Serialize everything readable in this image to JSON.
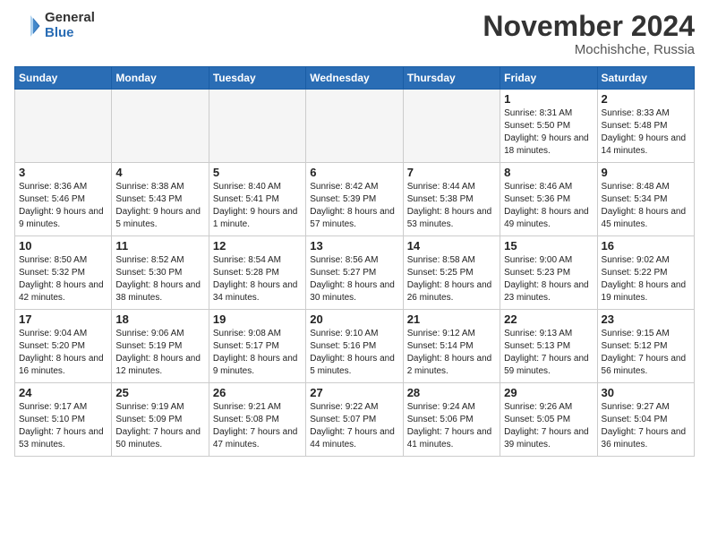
{
  "logo": {
    "general": "General",
    "blue": "Blue"
  },
  "header": {
    "month": "November 2024",
    "location": "Mochishche, Russia"
  },
  "weekdays": [
    "Sunday",
    "Monday",
    "Tuesday",
    "Wednesday",
    "Thursday",
    "Friday",
    "Saturday"
  ],
  "weeks": [
    [
      {
        "day": "",
        "empty": true
      },
      {
        "day": "",
        "empty": true
      },
      {
        "day": "",
        "empty": true
      },
      {
        "day": "",
        "empty": true
      },
      {
        "day": "",
        "empty": true
      },
      {
        "day": "1",
        "sunrise": "8:31 AM",
        "sunset": "5:50 PM",
        "daylight": "9 hours and 18 minutes."
      },
      {
        "day": "2",
        "sunrise": "8:33 AM",
        "sunset": "5:48 PM",
        "daylight": "9 hours and 14 minutes."
      }
    ],
    [
      {
        "day": "3",
        "sunrise": "8:36 AM",
        "sunset": "5:46 PM",
        "daylight": "9 hours and 9 minutes."
      },
      {
        "day": "4",
        "sunrise": "8:38 AM",
        "sunset": "5:43 PM",
        "daylight": "9 hours and 5 minutes."
      },
      {
        "day": "5",
        "sunrise": "8:40 AM",
        "sunset": "5:41 PM",
        "daylight": "9 hours and 1 minute."
      },
      {
        "day": "6",
        "sunrise": "8:42 AM",
        "sunset": "5:39 PM",
        "daylight": "8 hours and 57 minutes."
      },
      {
        "day": "7",
        "sunrise": "8:44 AM",
        "sunset": "5:38 PM",
        "daylight": "8 hours and 53 minutes."
      },
      {
        "day": "8",
        "sunrise": "8:46 AM",
        "sunset": "5:36 PM",
        "daylight": "8 hours and 49 minutes."
      },
      {
        "day": "9",
        "sunrise": "8:48 AM",
        "sunset": "5:34 PM",
        "daylight": "8 hours and 45 minutes."
      }
    ],
    [
      {
        "day": "10",
        "sunrise": "8:50 AM",
        "sunset": "5:32 PM",
        "daylight": "8 hours and 42 minutes."
      },
      {
        "day": "11",
        "sunrise": "8:52 AM",
        "sunset": "5:30 PM",
        "daylight": "8 hours and 38 minutes."
      },
      {
        "day": "12",
        "sunrise": "8:54 AM",
        "sunset": "5:28 PM",
        "daylight": "8 hours and 34 minutes."
      },
      {
        "day": "13",
        "sunrise": "8:56 AM",
        "sunset": "5:27 PM",
        "daylight": "8 hours and 30 minutes."
      },
      {
        "day": "14",
        "sunrise": "8:58 AM",
        "sunset": "5:25 PM",
        "daylight": "8 hours and 26 minutes."
      },
      {
        "day": "15",
        "sunrise": "9:00 AM",
        "sunset": "5:23 PM",
        "daylight": "8 hours and 23 minutes."
      },
      {
        "day": "16",
        "sunrise": "9:02 AM",
        "sunset": "5:22 PM",
        "daylight": "8 hours and 19 minutes."
      }
    ],
    [
      {
        "day": "17",
        "sunrise": "9:04 AM",
        "sunset": "5:20 PM",
        "daylight": "8 hours and 16 minutes."
      },
      {
        "day": "18",
        "sunrise": "9:06 AM",
        "sunset": "5:19 PM",
        "daylight": "8 hours and 12 minutes."
      },
      {
        "day": "19",
        "sunrise": "9:08 AM",
        "sunset": "5:17 PM",
        "daylight": "8 hours and 9 minutes."
      },
      {
        "day": "20",
        "sunrise": "9:10 AM",
        "sunset": "5:16 PM",
        "daylight": "8 hours and 5 minutes."
      },
      {
        "day": "21",
        "sunrise": "9:12 AM",
        "sunset": "5:14 PM",
        "daylight": "8 hours and 2 minutes."
      },
      {
        "day": "22",
        "sunrise": "9:13 AM",
        "sunset": "5:13 PM",
        "daylight": "7 hours and 59 minutes."
      },
      {
        "day": "23",
        "sunrise": "9:15 AM",
        "sunset": "5:12 PM",
        "daylight": "7 hours and 56 minutes."
      }
    ],
    [
      {
        "day": "24",
        "sunrise": "9:17 AM",
        "sunset": "5:10 PM",
        "daylight": "7 hours and 53 minutes."
      },
      {
        "day": "25",
        "sunrise": "9:19 AM",
        "sunset": "5:09 PM",
        "daylight": "7 hours and 50 minutes."
      },
      {
        "day": "26",
        "sunrise": "9:21 AM",
        "sunset": "5:08 PM",
        "daylight": "7 hours and 47 minutes."
      },
      {
        "day": "27",
        "sunrise": "9:22 AM",
        "sunset": "5:07 PM",
        "daylight": "7 hours and 44 minutes."
      },
      {
        "day": "28",
        "sunrise": "9:24 AM",
        "sunset": "5:06 PM",
        "daylight": "7 hours and 41 minutes."
      },
      {
        "day": "29",
        "sunrise": "9:26 AM",
        "sunset": "5:05 PM",
        "daylight": "7 hours and 39 minutes."
      },
      {
        "day": "30",
        "sunrise": "9:27 AM",
        "sunset": "5:04 PM",
        "daylight": "7 hours and 36 minutes."
      }
    ]
  ]
}
